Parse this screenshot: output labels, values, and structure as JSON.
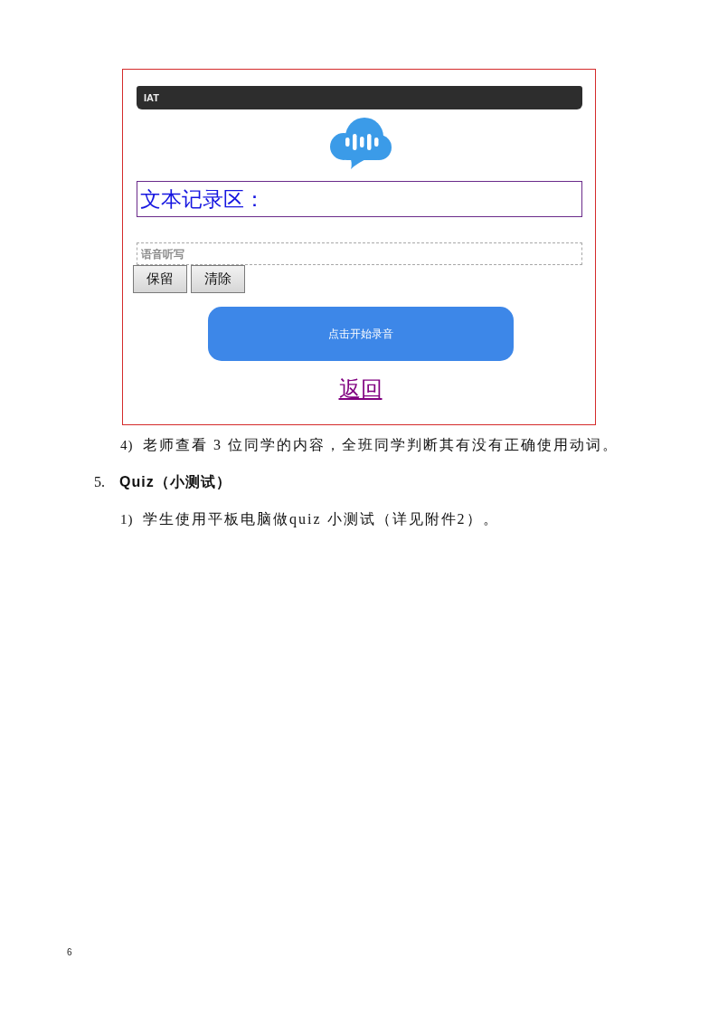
{
  "app": {
    "header": {
      "title": "IAT"
    },
    "transcript": {
      "label": "文本记录区："
    },
    "dictation_field": {
      "placeholder": "语音听写"
    },
    "buttons": [
      {
        "label": "保留"
      },
      {
        "label": "清除"
      }
    ],
    "record_button": {
      "label": "点击开始录音"
    },
    "back_link": {
      "label": "返回"
    }
  },
  "document": [
    {
      "kind": "step",
      "marker": "4)",
      "text": "老师查看 3 位同学的内容，全班同学判断其有没有正确使用动词。"
    },
    {
      "kind": "heading",
      "marker": "5.",
      "text": "Quiz（小测试）"
    },
    {
      "kind": "step",
      "marker": "1)",
      "text": "学生使用平板电脑做quiz 小测试（详见附件2）。"
    }
  ],
  "page_number": "6"
}
